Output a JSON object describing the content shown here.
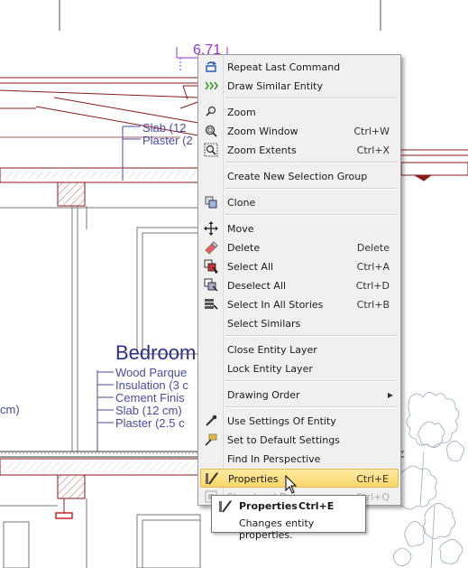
{
  "drawing": {
    "dimension_label": "6.71",
    "room_name": "Bedroom",
    "upper_layers": [
      "Slab (12",
      "Plaster (2"
    ],
    "lower_layers": [
      "Wood Parque",
      "Insulation (3 c",
      "Cement Finis",
      "Slab (12 cm)",
      "Plaster (2.5 c"
    ],
    "left_fragment": "cm)",
    "colors": {
      "line": "#8b1a1a",
      "text": "#4a4aa8",
      "dimension": "#9b30d9"
    }
  },
  "context_menu": {
    "items": [
      {
        "id": "repeat-last-command",
        "label": "Repeat Last Command",
        "shortcut": "",
        "icon": "repeat-icon"
      },
      {
        "id": "draw-similar-entity",
        "label": "Draw Similar Entity",
        "shortcut": "",
        "icon": "draw-similar-icon"
      },
      {
        "sep": true
      },
      {
        "id": "zoom",
        "label": "Zoom",
        "shortcut": "",
        "icon": "zoom-icon"
      },
      {
        "id": "zoom-window",
        "label": "Zoom Window",
        "shortcut": "Ctrl+W",
        "icon": "zoom-window-icon"
      },
      {
        "id": "zoom-extents",
        "label": "Zoom Extents",
        "shortcut": "Ctrl+X",
        "icon": "zoom-extents-icon"
      },
      {
        "sep": true
      },
      {
        "id": "create-new-selection-group",
        "label": "Create New Selection Group",
        "shortcut": "",
        "icon": ""
      },
      {
        "sep": true
      },
      {
        "id": "clone",
        "label": "Clone",
        "shortcut": "",
        "icon": "clone-icon"
      },
      {
        "sep": true
      },
      {
        "id": "move",
        "label": "Move",
        "shortcut": "",
        "icon": "move-icon"
      },
      {
        "id": "delete",
        "label": "Delete",
        "shortcut": "Delete",
        "icon": "eraser-icon"
      },
      {
        "id": "select-all",
        "label": "Select All",
        "shortcut": "Ctrl+A",
        "icon": "select-all-icon"
      },
      {
        "id": "deselect-all",
        "label": "Deselect All",
        "shortcut": "Ctrl+D",
        "icon": "deselect-all-icon"
      },
      {
        "id": "select-in-all-stories",
        "label": "Select In All Stories",
        "shortcut": "Ctrl+B",
        "icon": "select-stories-icon"
      },
      {
        "id": "select-similars",
        "label": "Select Similars",
        "shortcut": "",
        "icon": ""
      },
      {
        "sep": true
      },
      {
        "id": "close-entity-layer",
        "label": "Close Entity Layer",
        "shortcut": "",
        "icon": ""
      },
      {
        "id": "lock-entity-layer",
        "label": "Lock Entity Layer",
        "shortcut": "",
        "icon": ""
      },
      {
        "sep": true
      },
      {
        "id": "drawing-order",
        "label": "Drawing Order",
        "shortcut": "",
        "icon": "",
        "submenu": true
      },
      {
        "sep": true
      },
      {
        "id": "use-settings-of-entity",
        "label": "Use Settings Of Entity",
        "shortcut": "",
        "icon": "eyedropper-icon"
      },
      {
        "id": "set-to-default-settings",
        "label": "Set to Default Settings",
        "shortcut": "",
        "icon": "default-settings-icon"
      },
      {
        "id": "find-in-perspective",
        "label": "Find In Perspective",
        "shortcut": "",
        "icon": ""
      },
      {
        "id": "properties",
        "label": "Properties",
        "shortcut": "Ctrl+E",
        "icon": "properties-icon",
        "highlighted": true
      },
      {
        "id": "structural-data",
        "label": "Structural Data",
        "shortcut": "Ctrl+Q",
        "icon": "structural-icon",
        "disabled": true
      }
    ]
  },
  "tooltip": {
    "title": "Properties",
    "shortcut": "Ctrl+E",
    "description": "Changes entity properties."
  }
}
